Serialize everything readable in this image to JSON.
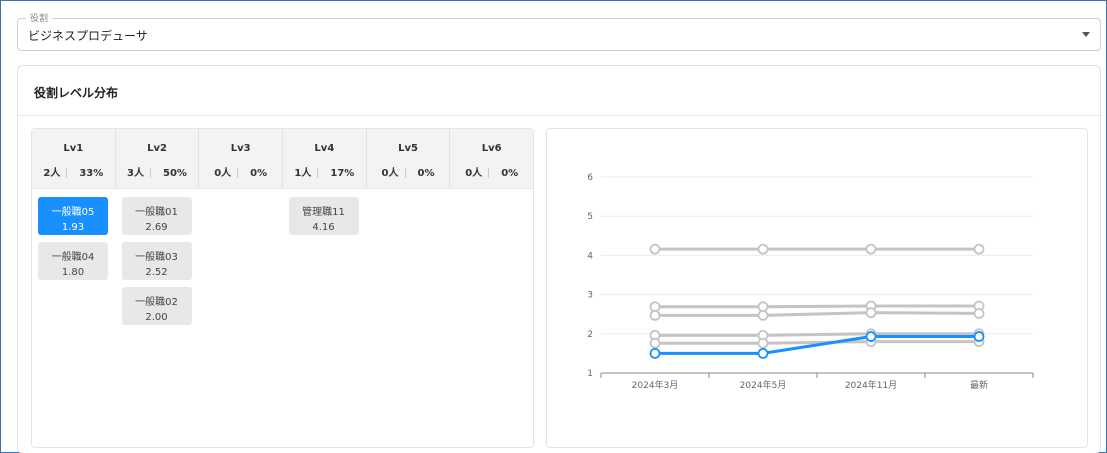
{
  "role_select": {
    "legend": "役割",
    "value": "ビジネスプロデューサ"
  },
  "card": {
    "title": "役割レベル分布"
  },
  "levels": [
    {
      "name": "Lv1",
      "count": "2人",
      "pct": "33%",
      "members": [
        {
          "name": "一般職05",
          "score": "1.93",
          "active": true
        },
        {
          "name": "一般職04",
          "score": "1.80",
          "active": false
        }
      ]
    },
    {
      "name": "Lv2",
      "count": "3人",
      "pct": "50%",
      "members": [
        {
          "name": "一般職01",
          "score": "2.69",
          "active": false
        },
        {
          "name": "一般職03",
          "score": "2.52",
          "active": false
        },
        {
          "name": "一般職02",
          "score": "2.00",
          "active": false
        }
      ]
    },
    {
      "name": "Lv3",
      "count": "0人",
      "pct": "0%",
      "members": []
    },
    {
      "name": "Lv4",
      "count": "1人",
      "pct": "17%",
      "members": [
        {
          "name": "管理職11",
          "score": "4.16",
          "active": false
        }
      ]
    },
    {
      "name": "Lv5",
      "count": "0人",
      "pct": "0%",
      "members": []
    },
    {
      "name": "Lv6",
      "count": "0人",
      "pct": "0%",
      "members": []
    }
  ],
  "chart_data": {
    "type": "line",
    "categories": [
      "2024年3月",
      "2024年5月",
      "2024年11月",
      "最新"
    ],
    "ylim": [
      1,
      6
    ],
    "yticks": [
      "1",
      "2",
      "3",
      "4",
      "5",
      "6"
    ],
    "grid": true,
    "highlight_color": "#1890ff",
    "base_color": "#c4c4c4",
    "series": [
      {
        "values": [
          4.16,
          4.16,
          4.16,
          4.16
        ],
        "highlight": false
      },
      {
        "values": [
          2.69,
          2.69,
          2.71,
          2.71
        ],
        "highlight": false
      },
      {
        "values": [
          2.47,
          2.47,
          2.54,
          2.52
        ],
        "highlight": false
      },
      {
        "values": [
          1.96,
          1.96,
          2.0,
          2.0
        ],
        "highlight": false
      },
      {
        "values": [
          1.76,
          1.76,
          1.8,
          1.8
        ],
        "highlight": false
      },
      {
        "values": [
          1.5,
          1.5,
          1.93,
          1.93
        ],
        "highlight": true
      }
    ]
  }
}
